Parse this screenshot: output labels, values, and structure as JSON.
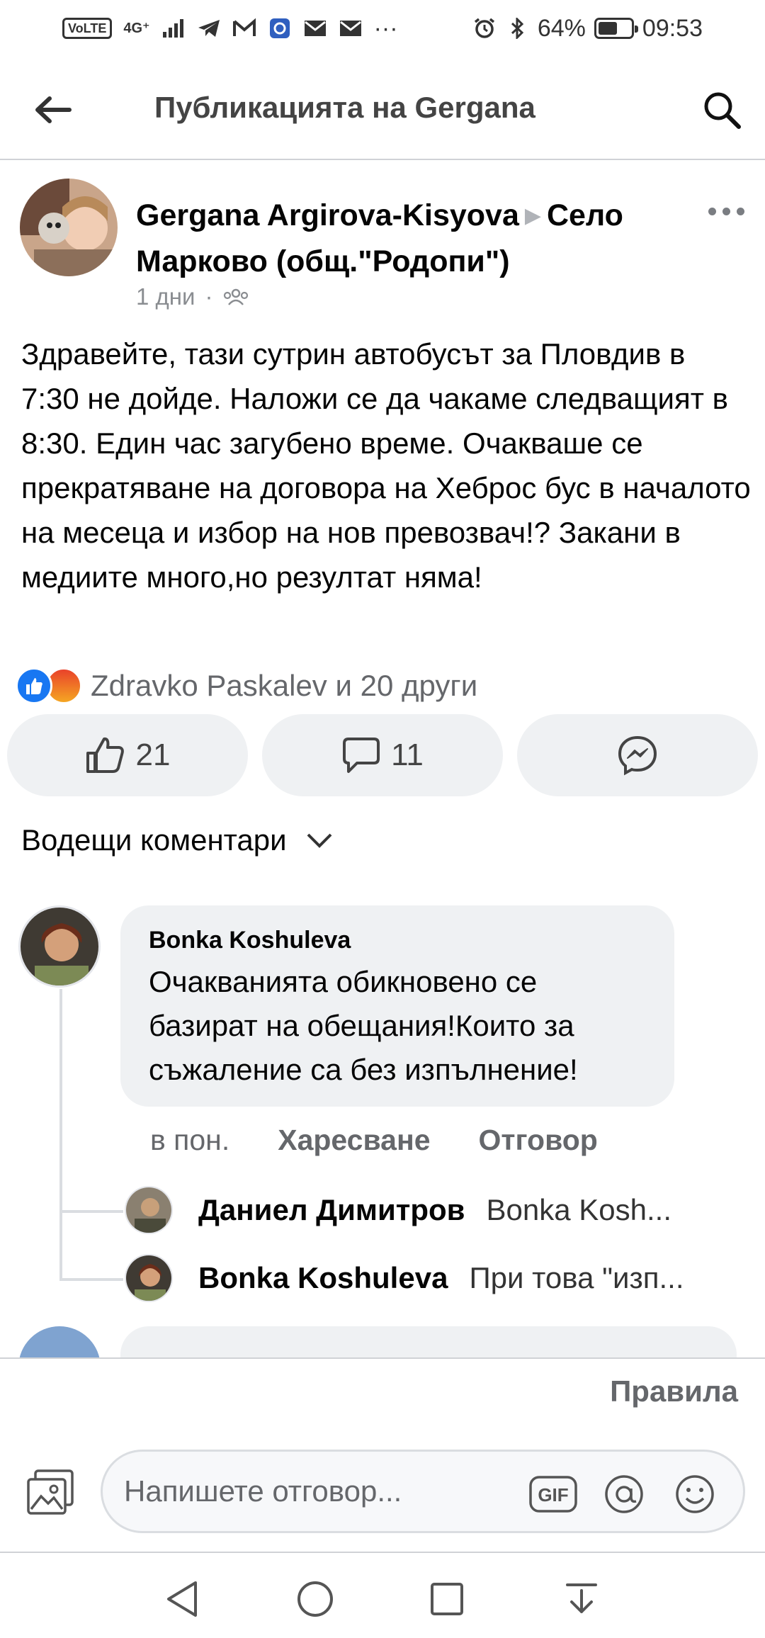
{
  "status_bar": {
    "volte": "VoLTE",
    "network": "4G⁺",
    "more": "···",
    "battery": "64%",
    "battery_level": 0.64,
    "time": "09:53",
    "icons": [
      "telegram-icon",
      "gmail-icon",
      "app-icon",
      "mail-icon",
      "mail-icon",
      "alarm-icon",
      "bluetooth-icon"
    ]
  },
  "header": {
    "title": "Публикацията на Gergana",
    "back_icon": "arrow-left-icon",
    "search_icon": "search-icon"
  },
  "post": {
    "author": "Gergana Argirova-Kisyova",
    "group": "Село Марково (общ.\"Родопи\")",
    "time": "1 дни",
    "separator": "·",
    "audience_icon": "group-icon",
    "text": "Здравейте, тази сутрин автобусът за Пловдив в 7:30 не дойде. Наложи се да чакаме следващият в 8:30. Един час загубено време. Очакваше се прекратяване на договора на Хеброс бус в началото на месеца и избор на нов превозвач!? Закани в медиите много,но резултат няма!",
    "reactions_summary": "Zdravko Paskalev и 20 други",
    "likes_count": "21",
    "comments_count": "11"
  },
  "comments_section": {
    "sort_label": "Водещи коментари"
  },
  "comment": {
    "author": "Bonka Koshuleva",
    "text": "Очакванията обикновено се базират на обещания!Които за съжаление са без изпълнение!",
    "time": "в пон.",
    "like_label": "Харесване",
    "reply_label": "Отговор"
  },
  "replies": [
    {
      "author": "Даниел Димитров",
      "text": "Bonka Kosh..."
    },
    {
      "author": "Bonka Koshuleva",
      "text": "При това \"изп..."
    }
  ],
  "composer": {
    "rules_label": "Правила",
    "placeholder": "Напишете отговор...",
    "gif_label": "GIF"
  },
  "colors": {
    "facebook_blue": "#1877f2",
    "bubble": "#eff1f3",
    "secondary_text": "#65676b"
  }
}
